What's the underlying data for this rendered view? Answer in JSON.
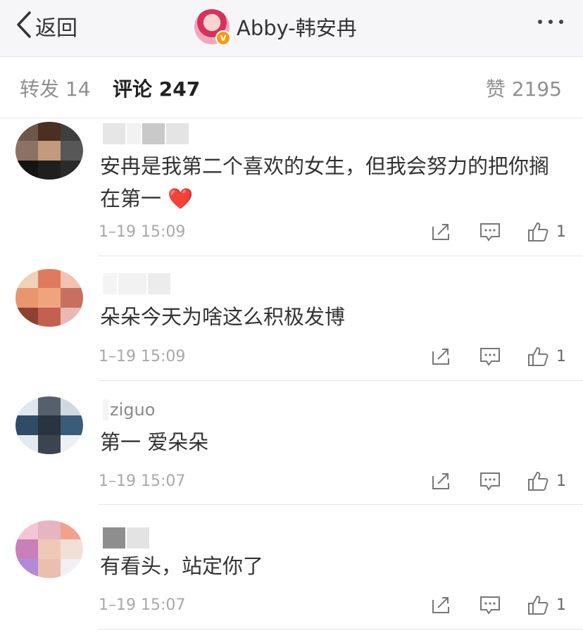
{
  "header": {
    "back_label": "返回",
    "title": "Abby-韩安冉",
    "verified_badge": "V"
  },
  "tabs": [
    {
      "label": "转发 14"
    },
    {
      "label": "评论 247"
    },
    {
      "label": "赞 2195"
    }
  ],
  "comments": [
    {
      "name": "",
      "text": "安冉是我第二个喜欢的女生，但我会努力的把你搁在第一",
      "emoji": "❤️",
      "time": "1–19 15:09",
      "likes": "1"
    },
    {
      "name": "",
      "text": "朵朵今天为啥这么积极发博",
      "time": "1–19 15:09",
      "likes": "1"
    },
    {
      "name": "ziguo",
      "text": "第一 爱朵朵",
      "time": "1–19 15:07",
      "likes": "1"
    },
    {
      "name": "",
      "text": "有看头，站定你了",
      "time": "1–19 15:07",
      "likes": "1"
    }
  ],
  "colors": {
    "topbar_bg": "#f6f6f8",
    "text_primary": "#333333",
    "text_muted": "#a8a8a8",
    "heart": "#e5262b",
    "verified": "#f39c12"
  }
}
